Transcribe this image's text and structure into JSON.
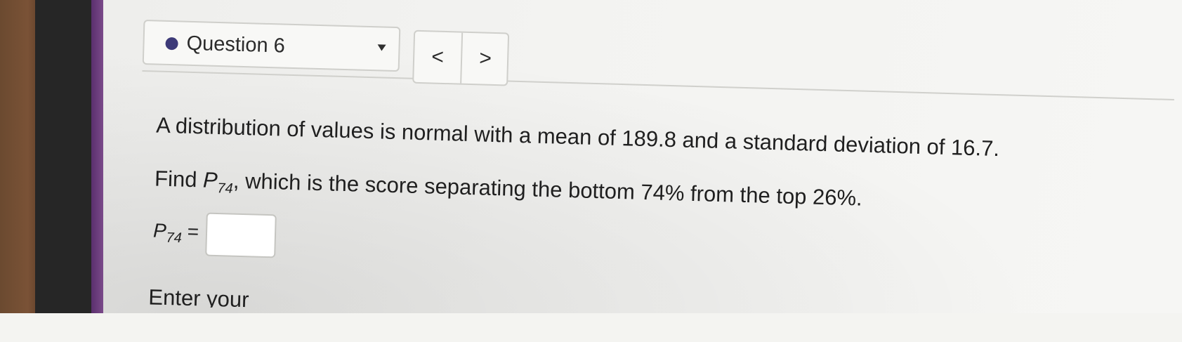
{
  "question_nav": {
    "label": "Question 6",
    "prev_label": "<",
    "next_label": ">",
    "status_color": "#3d3a78"
  },
  "question": {
    "text": "A distribution of values is normal with a mean of 189.8 and a standard deviation of 16.7.",
    "find_prefix": "Find ",
    "symbol_letter": "P",
    "symbol_subscript": "74",
    "find_suffix": ", which is the score separating the bottom 74% from the top 26%.",
    "answer_equals": "=",
    "answer_value": "",
    "partial_footer": "Enter your"
  }
}
